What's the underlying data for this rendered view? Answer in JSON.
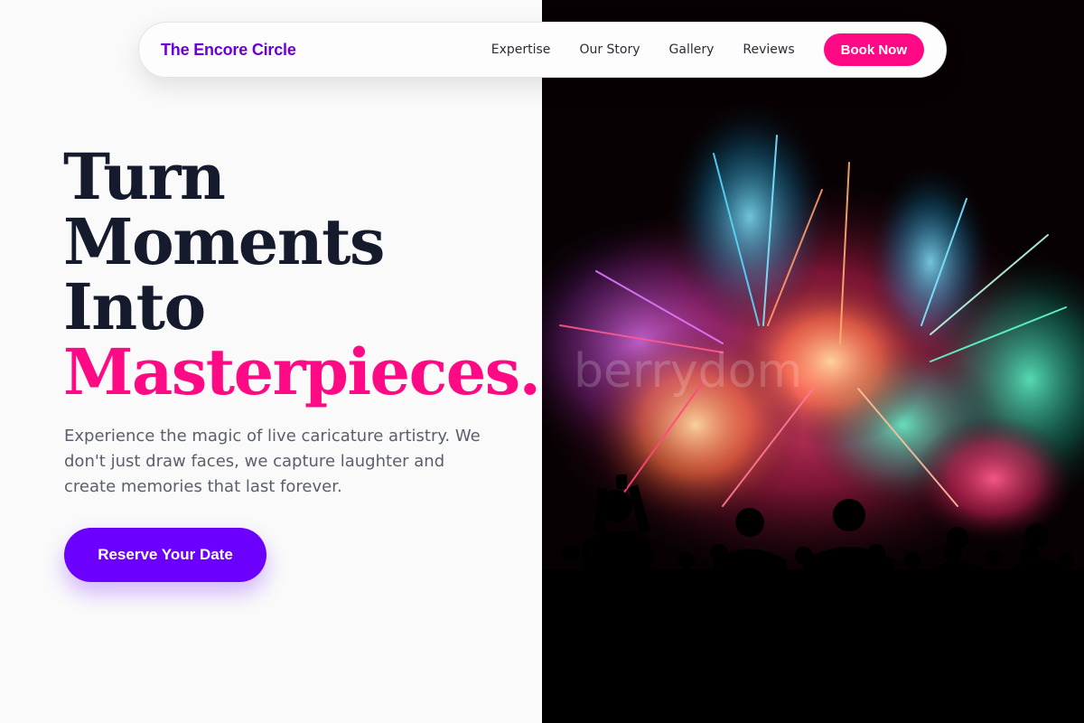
{
  "nav": {
    "brand": "The Encore Circle",
    "links": [
      "Expertise",
      "Our Story",
      "Gallery",
      "Reviews"
    ],
    "cta": "Book Now"
  },
  "hero": {
    "title_lines": [
      "Turn",
      "Moments",
      "Into"
    ],
    "title_accent": "Masterpieces.",
    "copy": "Experience the magic of live caricature artistry. We don't just draw faces, we capture laughter and create memories that last forever.",
    "cta": "Reserve Your Date"
  },
  "image": {
    "alt": "Crowd silhouetted against colorful fireworks display",
    "watermark": "berrydom"
  },
  "colors": {
    "brand": "#6a00d8",
    "accent_pink": "#ff0a84",
    "cta_purple": "#6b00ff",
    "heading": "#151a2c",
    "body_text": "#5a5f6c"
  }
}
